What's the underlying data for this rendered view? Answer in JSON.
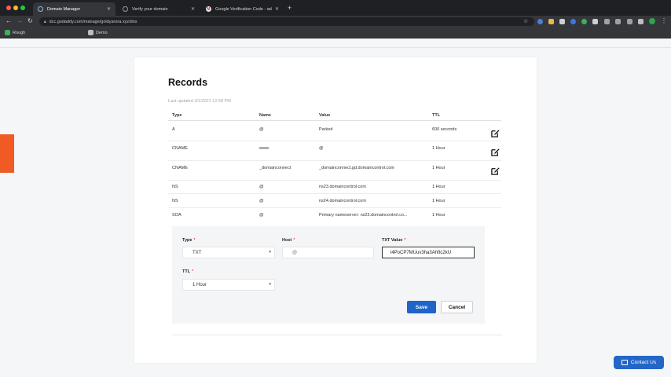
{
  "browser": {
    "tabs": [
      {
        "title": "Domain Manager",
        "active": true
      },
      {
        "title": "Verify your domain",
        "active": false
      },
      {
        "title": "Google Verification Code - adm",
        "active": false
      }
    ],
    "url": "dcc.godaddy.com/manage/goldyarora.xyz/dns",
    "bookmarks": [
      "Rough",
      "Demo"
    ]
  },
  "records": {
    "title": "Records",
    "last_updated": "Last updated 3/1/2021 12:58 PM",
    "columns": {
      "type": "Type",
      "name": "Name",
      "value": "Value",
      "ttl": "TTL"
    },
    "rows": [
      {
        "type": "A",
        "name": "@",
        "value": "Parked",
        "ttl": "600 seconds",
        "editable": true
      },
      {
        "type": "CNAME",
        "name": "www",
        "value": "@",
        "ttl": "1 Hour",
        "editable": true
      },
      {
        "type": "CNAME",
        "name": "_domainconnect",
        "value": "_domainconnect.gd.domaincontrol.com",
        "ttl": "1 Hour",
        "editable": true
      },
      {
        "type": "NS",
        "name": "@",
        "value": "ns23.domaincontrol.com",
        "ttl": "1 Hour",
        "editable": false
      },
      {
        "type": "NS",
        "name": "@",
        "value": "ns24.domaincontrol.com",
        "ttl": "1 Hour",
        "editable": false
      },
      {
        "type": "SOA",
        "name": "@",
        "value": "Primary nameserver: ns23.domaincontrol.co...",
        "ttl": "1 Hour",
        "editable": false
      }
    ]
  },
  "form": {
    "type_label": "Type",
    "type_value": "TXT",
    "host_label": "Host",
    "host_value": "@",
    "txt_label": "TXT Value",
    "txt_value": "l4PoCP7MUuv3ha3Ahftc2kU",
    "ttl_label": "TTL",
    "ttl_value": "1 Hour",
    "required_mark": "*",
    "save_label": "Save",
    "cancel_label": "Cancel"
  },
  "contact_label": "Contact Us",
  "colors": {
    "accent": "#1f64c8",
    "side_tab": "#f05a24"
  }
}
